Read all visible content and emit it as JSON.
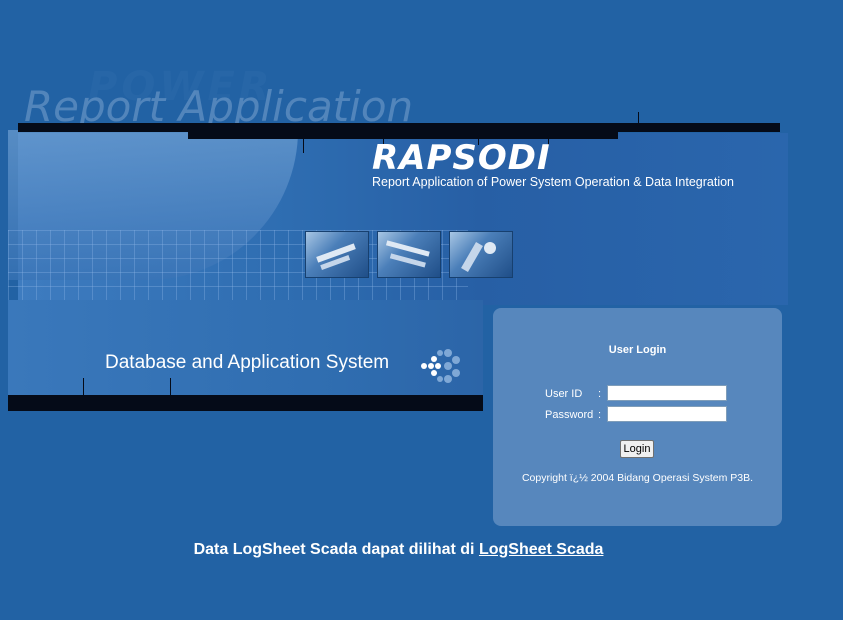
{
  "banner": {
    "ghost_title": "Report Application",
    "ghost_back": "POWER",
    "brand": "RAPSODI",
    "tagline": "Report Application of Power System Operation & Data Integration",
    "db_label": "Database and Application System"
  },
  "login": {
    "title": "User Login",
    "user_id_label": "User ID",
    "password_label": "Password",
    "colon": ":",
    "user_id_value": "",
    "password_value": "",
    "button_label": "Login",
    "copyright": "Copyright ï¿½ 2004 Bidang Operasi System P3B."
  },
  "footer": {
    "text": "Data LogSheet Scada dapat dilihat di",
    "link_label": "LogSheet Scada"
  },
  "colors": {
    "page_bg": "#2262a4",
    "login_bg": "#5787bd"
  }
}
